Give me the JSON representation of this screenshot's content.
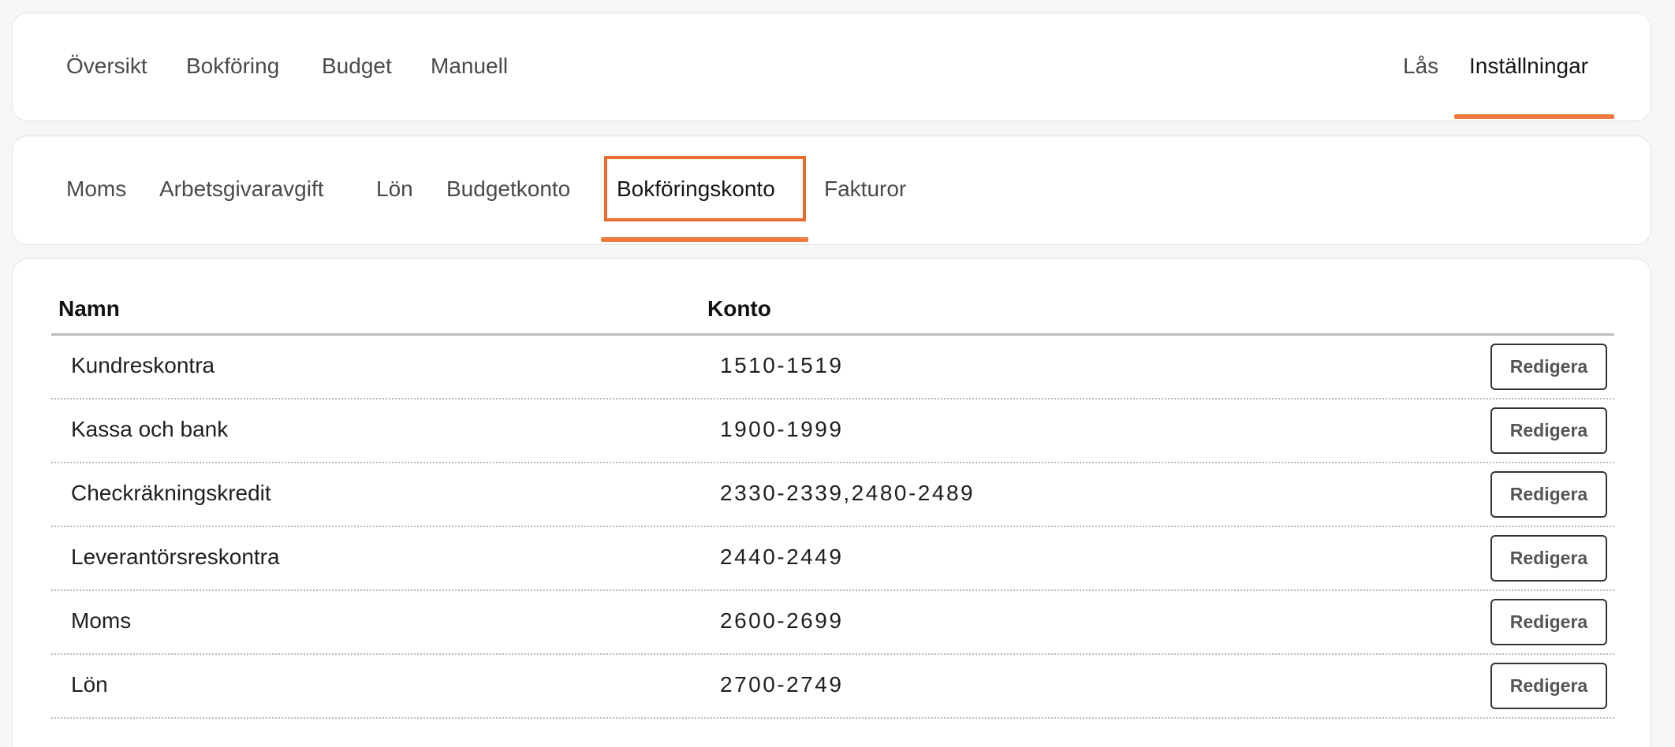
{
  "main_nav": {
    "items": [
      "Översikt",
      "Bokföring",
      "Budget",
      "Manuell"
    ],
    "right_items": [
      "Lås",
      "Inställningar"
    ],
    "active": "Inställningar"
  },
  "sub_nav": {
    "items": [
      "Moms",
      "Arbetsgivaravgift",
      "Lön",
      "Budgetkonto",
      "Bokföringskonto",
      "Fakturor"
    ],
    "active": "Bokföringskonto"
  },
  "table": {
    "headers": {
      "name": "Namn",
      "konto": "Konto"
    },
    "edit_label": "Redigera",
    "rows": [
      {
        "name": "Kundreskontra",
        "konto": "1510-1519"
      },
      {
        "name": "Kassa och bank",
        "konto": "1900-1999"
      },
      {
        "name": "Checkräkningskredit",
        "konto": "2330-2339,2480-2489"
      },
      {
        "name": "Leverantörsreskontra",
        "konto": "2440-2449"
      },
      {
        "name": "Moms",
        "konto": "2600-2699"
      },
      {
        "name": "Lön",
        "konto": "2700-2749"
      }
    ]
  },
  "colors": {
    "accent": "#ee7b3c",
    "focus_border": "#e66d2d"
  }
}
